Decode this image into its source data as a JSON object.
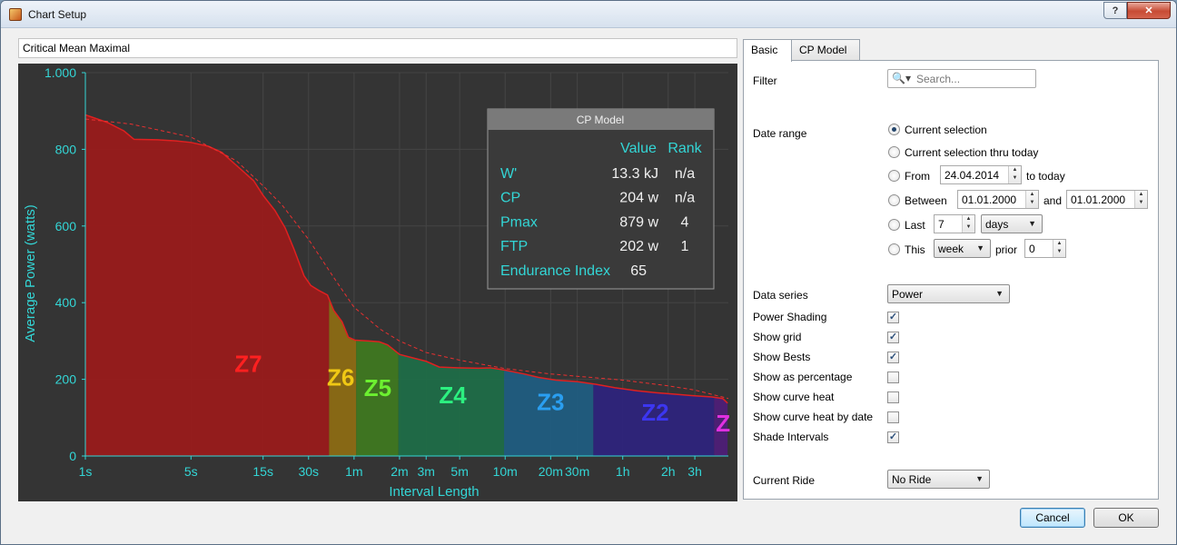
{
  "window": {
    "title": "Chart Setup"
  },
  "chart_name": "Critical Mean Maximal",
  "tabs": [
    {
      "label": "Basic",
      "active": true
    },
    {
      "label": "CP Model",
      "active": false
    }
  ],
  "basic": {
    "filter_label": "Filter",
    "search_placeholder": "Search...",
    "date_range_label": "Date range",
    "date_options": {
      "current": "Current selection",
      "thru_today": "Current selection thru today",
      "from": "From",
      "from_date": "24.04.2014",
      "to_today": "to today",
      "between": "Between",
      "between_start": "01.01.2000",
      "and": "and",
      "between_end": "01.01.2000",
      "last": "Last",
      "last_value": "7",
      "last_unit": "days",
      "this": "This",
      "this_unit": "week",
      "prior": "prior",
      "prior_value": "0",
      "selected": "current"
    },
    "data_series_label": "Data series",
    "data_series_value": "Power",
    "checkboxes": [
      {
        "label": "Power Shading",
        "checked": true
      },
      {
        "label": "Show grid",
        "checked": true
      },
      {
        "label": "Show Bests",
        "checked": true
      },
      {
        "label": "Show as percentage",
        "checked": false
      },
      {
        "label": "Show curve heat",
        "checked": false
      },
      {
        "label": "Show curve heat by date",
        "checked": false
      },
      {
        "label": "Shade Intervals",
        "checked": true
      }
    ],
    "current_ride_label": "Current Ride",
    "current_ride_value": "No Ride"
  },
  "buttons": {
    "cancel": "Cancel",
    "ok": "OK"
  },
  "chart_data": {
    "type": "area",
    "x_scale": "log",
    "xlabel": "Interval Length",
    "ylabel": "Average Power (watts)",
    "ylim": [
      0,
      1000
    ],
    "y_ticks": [
      {
        "value": 0,
        "label": "0"
      },
      {
        "value": 200,
        "label": "200"
      },
      {
        "value": 400,
        "label": "400"
      },
      {
        "value": 600,
        "label": "600"
      },
      {
        "value": 800,
        "label": "800"
      },
      {
        "value": 1000,
        "label": "1.000"
      }
    ],
    "x_ticks": [
      {
        "value": 1,
        "label": "1s"
      },
      {
        "value": 5,
        "label": "5s"
      },
      {
        "value": 15,
        "label": "15s"
      },
      {
        "value": 30,
        "label": "30s"
      },
      {
        "value": 60,
        "label": "1m"
      },
      {
        "value": 120,
        "label": "2m"
      },
      {
        "value": 180,
        "label": "3m"
      },
      {
        "value": 300,
        "label": "5m"
      },
      {
        "value": 600,
        "label": "10m"
      },
      {
        "value": 1200,
        "label": "20m"
      },
      {
        "value": 1800,
        "label": "30m"
      },
      {
        "value": 3600,
        "label": "1h"
      },
      {
        "value": 7200,
        "label": "2h"
      },
      {
        "value": 10800,
        "label": "3h"
      }
    ],
    "x_max": 18000,
    "grid": true,
    "colors": {
      "background": "#343434",
      "axis": "#33d6d6",
      "curve": "#e02020",
      "model": "#e83030"
    },
    "mean_max": [
      {
        "x": 1,
        "y": 890
      },
      {
        "x": 1.4,
        "y": 870
      },
      {
        "x": 1.8,
        "y": 848
      },
      {
        "x": 2.1,
        "y": 826
      },
      {
        "x": 3,
        "y": 825
      },
      {
        "x": 4,
        "y": 822
      },
      {
        "x": 5,
        "y": 818
      },
      {
        "x": 6.5,
        "y": 808
      },
      {
        "x": 8,
        "y": 792
      },
      {
        "x": 10,
        "y": 758
      },
      {
        "x": 13,
        "y": 718
      },
      {
        "x": 15,
        "y": 680
      },
      {
        "x": 18,
        "y": 640
      },
      {
        "x": 21,
        "y": 595
      },
      {
        "x": 24,
        "y": 540
      },
      {
        "x": 28,
        "y": 470
      },
      {
        "x": 31,
        "y": 445
      },
      {
        "x": 35,
        "y": 432
      },
      {
        "x": 40,
        "y": 420
      },
      {
        "x": 44,
        "y": 380
      },
      {
        "x": 50,
        "y": 350
      },
      {
        "x": 55,
        "y": 310
      },
      {
        "x": 61,
        "y": 302
      },
      {
        "x": 75,
        "y": 300
      },
      {
        "x": 88,
        "y": 298
      },
      {
        "x": 100,
        "y": 290
      },
      {
        "x": 120,
        "y": 265
      },
      {
        "x": 150,
        "y": 255
      },
      {
        "x": 180,
        "y": 247
      },
      {
        "x": 220,
        "y": 232
      },
      {
        "x": 300,
        "y": 230
      },
      {
        "x": 400,
        "y": 229
      },
      {
        "x": 480,
        "y": 230
      },
      {
        "x": 600,
        "y": 224
      },
      {
        "x": 800,
        "y": 214
      },
      {
        "x": 1000,
        "y": 205
      },
      {
        "x": 1300,
        "y": 198
      },
      {
        "x": 1800,
        "y": 194
      },
      {
        "x": 2400,
        "y": 187
      },
      {
        "x": 3200,
        "y": 178
      },
      {
        "x": 4500,
        "y": 170
      },
      {
        "x": 6000,
        "y": 165
      },
      {
        "x": 8000,
        "y": 161
      },
      {
        "x": 10800,
        "y": 157
      },
      {
        "x": 14000,
        "y": 154
      },
      {
        "x": 16500,
        "y": 150
      },
      {
        "x": 17800,
        "y": 138
      }
    ],
    "cp_model_curve": [
      {
        "x": 1,
        "y": 879
      },
      {
        "x": 2,
        "y": 866
      },
      {
        "x": 5,
        "y": 832
      },
      {
        "x": 10,
        "y": 770
      },
      {
        "x": 15,
        "y": 705
      },
      {
        "x": 20,
        "y": 655
      },
      {
        "x": 30,
        "y": 565
      },
      {
        "x": 45,
        "y": 460
      },
      {
        "x": 60,
        "y": 388
      },
      {
        "x": 90,
        "y": 330
      },
      {
        "x": 120,
        "y": 300
      },
      {
        "x": 180,
        "y": 270
      },
      {
        "x": 300,
        "y": 250
      },
      {
        "x": 600,
        "y": 228
      },
      {
        "x": 1200,
        "y": 214
      },
      {
        "x": 1800,
        "y": 208
      },
      {
        "x": 3600,
        "y": 198
      },
      {
        "x": 7200,
        "y": 183
      },
      {
        "x": 10800,
        "y": 172
      },
      {
        "x": 18000,
        "y": 150
      }
    ],
    "zones": [
      {
        "label": "Z7",
        "x_from": 1,
        "x_to": 41,
        "color": "#9b1a1a",
        "label_color": "#ff2020"
      },
      {
        "label": "Z6",
        "x_from": 41,
        "x_to": 62,
        "color": "#8e6d12",
        "label_color": "#f0c814"
      },
      {
        "label": "Z5",
        "x_from": 62,
        "x_to": 118,
        "color": "#3f7a1f",
        "label_color": "#6cf030"
      },
      {
        "label": "Z4",
        "x_from": 118,
        "x_to": 590,
        "color": "#1d6e48",
        "label_color": "#2cf080"
      },
      {
        "label": "Z3",
        "x_from": 590,
        "x_to": 2300,
        "color": "#1e5d82",
        "label_color": "#2a9ef0"
      },
      {
        "label": "Z2",
        "x_from": 2300,
        "x_to": 14500,
        "color": "#2e237e",
        "label_color": "#3c36f0"
      },
      {
        "label": "Z",
        "x_from": 14500,
        "x_to": 18000,
        "color": "#4e1d78",
        "label_color": "#e030e0"
      }
    ],
    "cp_table": {
      "title": "CP Model",
      "headers": [
        "",
        "Value",
        "Rank"
      ],
      "rows": [
        {
          "name": "W'",
          "value": "13.3 kJ",
          "rank": "n/a"
        },
        {
          "name": "CP",
          "value": "204 w",
          "rank": "n/a"
        },
        {
          "name": "Pmax",
          "value": "879 w",
          "rank": "4"
        },
        {
          "name": "FTP",
          "value": "202 w",
          "rank": "1"
        },
        {
          "name": "Endurance Index",
          "value": "65",
          "rank": ""
        }
      ]
    }
  }
}
